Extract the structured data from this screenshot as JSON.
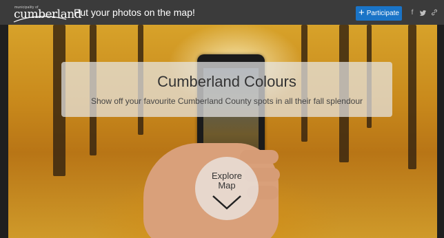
{
  "header": {
    "brand_small": "municipality of",
    "brand_name": "cumberland",
    "tagline": "Put your photos on the map!",
    "participate_label": "Participate"
  },
  "social": [
    {
      "icon": "facebook-icon",
      "glyph": "f"
    },
    {
      "icon": "twitter-icon",
      "glyph": "🐦"
    },
    {
      "icon": "link-icon",
      "glyph": "🔗"
    }
  ],
  "hero": {
    "title": "Cumberland Colours",
    "subtitle": "Show off your favourite Cumberland County spots in all their fall splendour",
    "explore_label": "Explore Map"
  },
  "colors": {
    "topbar": "#3b3b3b",
    "accent": "#1a74c7",
    "panel": "rgba(230,230,230,0.72)"
  }
}
